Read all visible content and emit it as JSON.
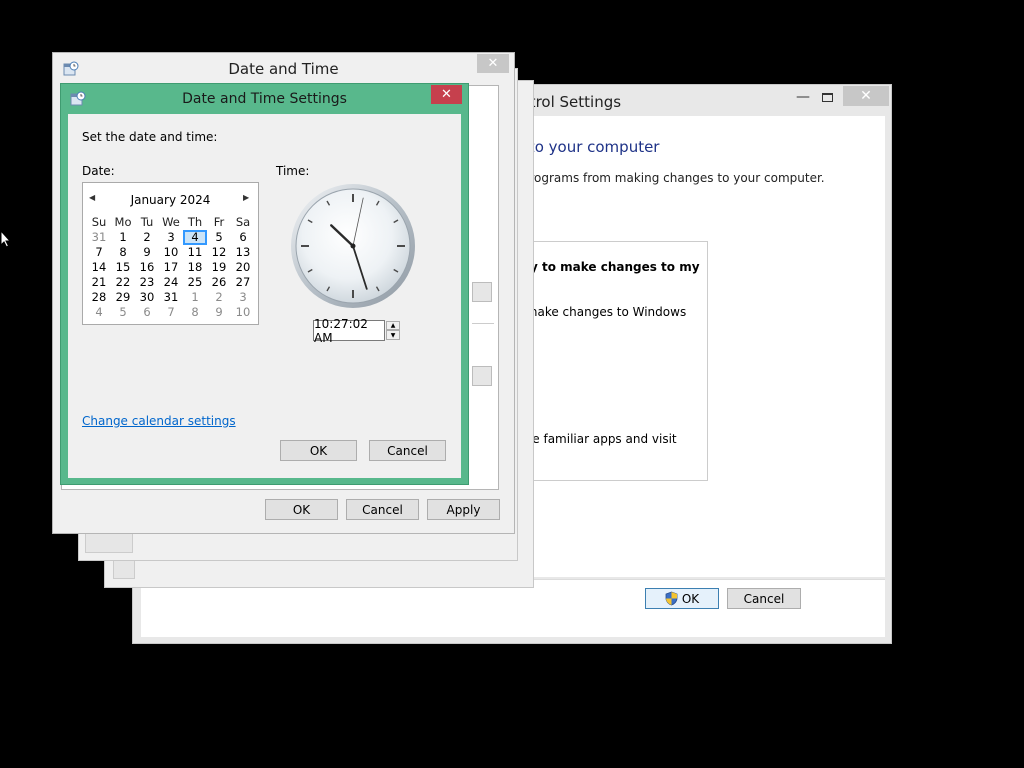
{
  "uac_window": {
    "title": "ontrol Settings",
    "heading": "es to your computer",
    "description": "ul programs from making changes to your computer.",
    "option_bold": "s try to make changes to my",
    "option2": "n I make changes to Windows",
    "option3": "u use familiar apps and visit",
    "ok_label": "OK",
    "cancel_label": "Cancel",
    "close_glyph": "✕",
    "minimize_glyph": "—"
  },
  "date_time_window": {
    "title": "Date and Time",
    "ok_label": "OK",
    "cancel_label": "Cancel",
    "apply_label": "Apply",
    "close_glyph": "✕"
  },
  "settings_dialog": {
    "title": "Date and Time Settings",
    "set_label": "Set the date and time:",
    "date_label": "Date:",
    "time_label": "Time:",
    "time_value": "10:27:02 AM",
    "link_label": "Change calendar settings",
    "ok_label": "OK",
    "cancel_label": "Cancel",
    "close_glyph": "✕",
    "accent_color": "#58b88c",
    "close_color": "#c6404d"
  },
  "calendar": {
    "month": "January 2024",
    "prev_glyph": "◀",
    "next_glyph": "▶",
    "weekdays": [
      "Su",
      "Mo",
      "Tu",
      "We",
      "Th",
      "Fr",
      "Sa"
    ],
    "weeks": [
      [
        "31",
        "1",
        "2",
        "3",
        "4",
        "5",
        "6"
      ],
      [
        "7",
        "8",
        "9",
        "10",
        "11",
        "12",
        "13"
      ],
      [
        "14",
        "15",
        "16",
        "17",
        "18",
        "19",
        "20"
      ],
      [
        "21",
        "22",
        "23",
        "24",
        "25",
        "26",
        "27"
      ],
      [
        "28",
        "29",
        "30",
        "31",
        "1",
        "2",
        "3"
      ],
      [
        "4",
        "5",
        "6",
        "7",
        "8",
        "9",
        "10"
      ]
    ],
    "selected_day": "4"
  },
  "clock": {
    "hour": 10,
    "minute": 27,
    "second": 2
  }
}
